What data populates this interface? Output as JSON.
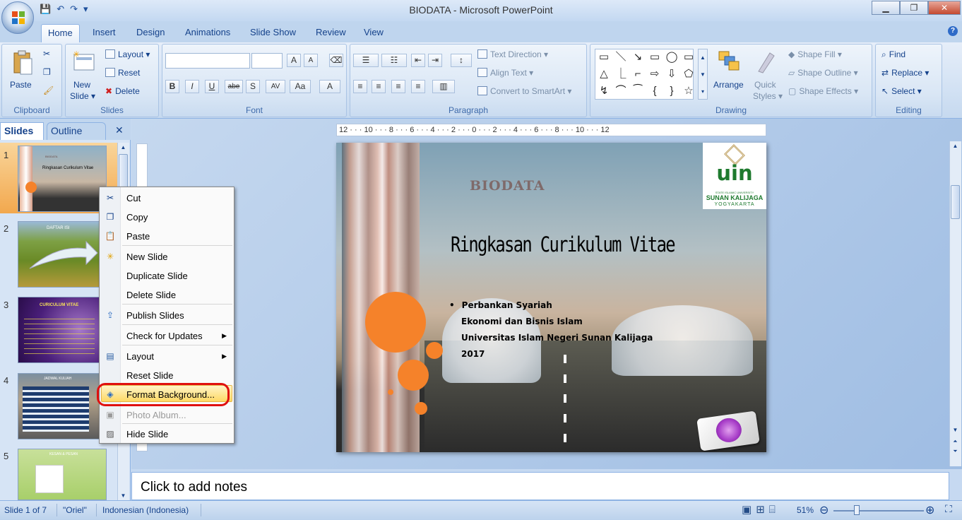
{
  "window": {
    "title": "BIODATA - Microsoft PowerPoint"
  },
  "qat": {
    "save": "💾",
    "undo": "↶",
    "redo": "↷",
    "more": "▾"
  },
  "window_buttons": {
    "minimize": "▁",
    "restore": "❐",
    "close": "✕"
  },
  "tabs": [
    {
      "label": "Home"
    },
    {
      "label": "Insert"
    },
    {
      "label": "Design"
    },
    {
      "label": "Animations"
    },
    {
      "label": "Slide Show"
    },
    {
      "label": "Review"
    },
    {
      "label": "View"
    }
  ],
  "help": "?",
  "ribbon": {
    "clipboard": {
      "label": "Clipboard",
      "paste": "Paste"
    },
    "slides": {
      "label": "Slides",
      "new_slide": "New",
      "new_slide2": "Slide ▾",
      "layout": "Layout ▾",
      "reset": "Reset",
      "delete": "Delete"
    },
    "font": {
      "label": "Font",
      "buttons": [
        "B",
        "I",
        "U",
        "abe",
        "S",
        "AV",
        "Aa",
        "A"
      ],
      "grow": "A",
      "shrink": "A"
    },
    "paragraph": {
      "label": "Paragraph",
      "text_direction": "Text Direction ▾",
      "align_text": "Align Text ▾",
      "convert": "Convert to SmartArt ▾"
    },
    "drawing": {
      "label": "Drawing",
      "arrange": "Arrange",
      "quick_styles": "Quick",
      "quick_styles2": "Styles ▾",
      "shape_fill": "Shape Fill ▾",
      "shape_outline": "Shape Outline ▾",
      "shape_effects": "Shape Effects ▾",
      "shapes": [
        "▭",
        "＼",
        "↘",
        "▭",
        "◯",
        "▭",
        "△",
        "⎿",
        "⌐",
        "⇨",
        "⇩",
        "⬠",
        "↯",
        "⌒",
        "⁀",
        "{",
        "}",
        "☆"
      ]
    },
    "editing": {
      "label": "Editing",
      "find": "Find",
      "replace": "Replace ▾",
      "select": "Select ▾"
    }
  },
  "pane": {
    "tab_slides": "Slides",
    "tab_outline": "Outline",
    "close": "✕"
  },
  "thumbnails": [
    {
      "num": "1",
      "title": "Ringkasan Curikulum Vitae",
      "head": "BIODATA"
    },
    {
      "num": "2",
      "title": "DAFTAR ISI"
    },
    {
      "num": "3",
      "title": "CURICULUM VITAE"
    },
    {
      "num": "4",
      "title": "JADWAL KULIAH"
    },
    {
      "num": "5",
      "title": "KESAN & PESAN"
    }
  ],
  "context_menu": [
    {
      "label": "Cut",
      "icon": "✂",
      "enabled": true
    },
    {
      "label": "Copy",
      "icon": "❐",
      "enabled": true
    },
    {
      "label": "Paste",
      "icon": "📋",
      "enabled": true
    },
    {
      "label": "New Slide",
      "icon": "✳",
      "enabled": true
    },
    {
      "label": "Duplicate Slide",
      "icon": "",
      "enabled": true
    },
    {
      "label": "Delete Slide",
      "icon": "",
      "enabled": true
    },
    {
      "label": "Publish Slides",
      "icon": "⇪",
      "enabled": true
    },
    {
      "label": "Check for Updates",
      "icon": "",
      "enabled": true,
      "submenu": true
    },
    {
      "label": "Layout",
      "icon": "▤",
      "enabled": true,
      "submenu": true
    },
    {
      "label": "Reset Slide",
      "icon": "",
      "enabled": true
    },
    {
      "label": "Format Background...",
      "icon": "◈",
      "enabled": true,
      "highlighted": true
    },
    {
      "label": "Photo Album...",
      "icon": "▣",
      "enabled": false
    },
    {
      "label": "Hide Slide",
      "icon": "▨",
      "enabled": true
    }
  ],
  "ruler": {
    "text": "12 · · · 10 · · · 8 · · · 6 · · · 4 · · · 2 · · · 0 · · · 2 · · · 4 · · · 6 · · · 8 · · · 10 · · · 12"
  },
  "slide": {
    "heading": "BIODATA",
    "title": "Ringkasan Curikulum Vitae",
    "bullets": [
      "Perbankan Syariah",
      "Ekonomi dan Bisnis Islam",
      "Universitas Islam Negeri Sunan Kalijaga",
      "2017"
    ],
    "logo_line1": "STATE ISLAMIC UNIVERSITY",
    "logo_line2": "SUNAN KALIJAGA",
    "logo_line3": "YOGYAKARTA",
    "logo_mark": "uin",
    "accent_orange": "#f5822a"
  },
  "notes": {
    "placeholder": "Click to add notes"
  },
  "status": {
    "slide": "Slide 1 of 7",
    "theme": "\"Oriel\"",
    "language": "Indonesian (Indonesia)",
    "zoom": "51%"
  }
}
